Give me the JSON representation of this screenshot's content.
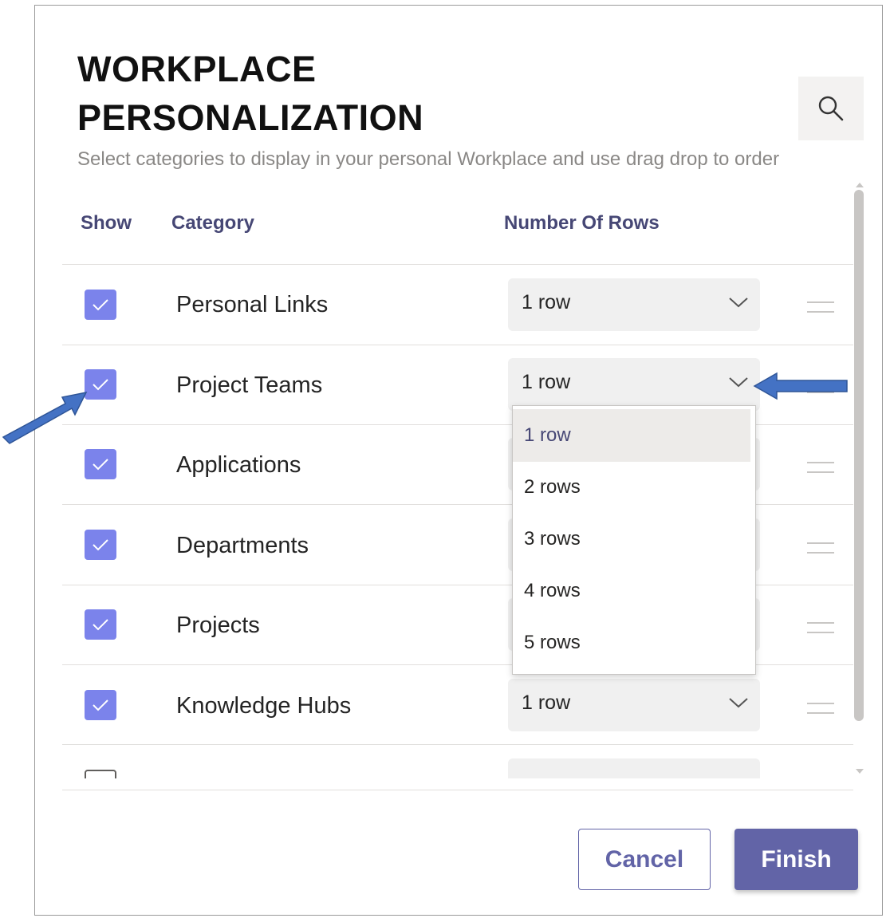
{
  "dialog": {
    "title": "WORKPLACE PERSONALIZATION",
    "subtitle": "Select categories to display in your personal Workplace and use drag drop to order",
    "search_icon": "search-icon"
  },
  "table": {
    "headers": {
      "show": "Show",
      "category": "Category",
      "rows": "Number Of Rows"
    },
    "rows": [
      {
        "checked": true,
        "category": "Personal Links",
        "rows_value": "1 row"
      },
      {
        "checked": true,
        "category": "Project Teams",
        "rows_value": "1 row"
      },
      {
        "checked": true,
        "category": "Applications",
        "rows_value": ""
      },
      {
        "checked": true,
        "category": "Departments",
        "rows_value": ""
      },
      {
        "checked": true,
        "category": "Projects",
        "rows_value": ""
      },
      {
        "checked": true,
        "category": "Knowledge Hubs",
        "rows_value": "1 row"
      }
    ]
  },
  "dropdown": {
    "options": [
      "1 row",
      "2 rows",
      "3 rows",
      "4 rows",
      "5 rows"
    ],
    "selected": "1 row"
  },
  "footer": {
    "cancel": "Cancel",
    "finish": "Finish"
  },
  "colors": {
    "accent": "#6264a7",
    "checkbox": "#7b83eb",
    "header_text": "#464775",
    "annotation_arrow": "#4472c4"
  }
}
